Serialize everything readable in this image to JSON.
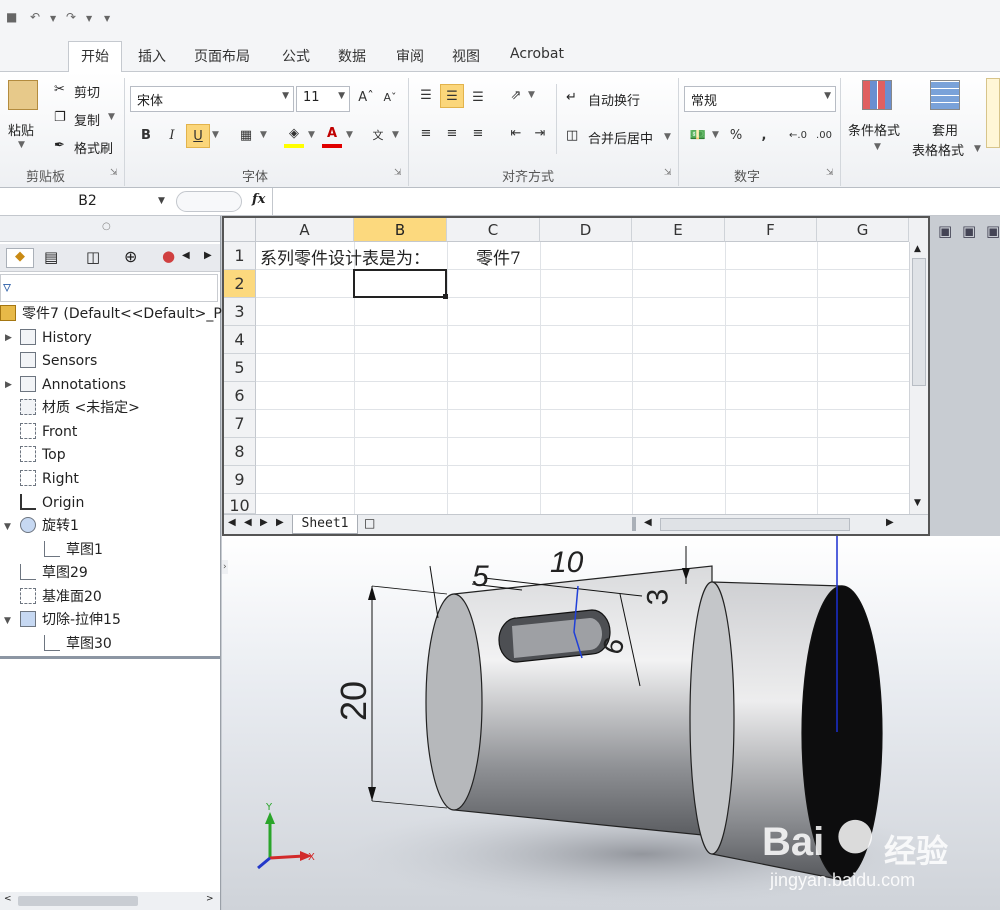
{
  "ribbon": {
    "tabs": [
      "开始",
      "插入",
      "页面布局",
      "公式",
      "数据",
      "审阅",
      "视图",
      "Acrobat"
    ],
    "active_tab": "开始",
    "clipboard": {
      "paste": "粘贴",
      "cut": "剪切",
      "copy": "复制",
      "format_painter": "格式刷",
      "group": "剪贴板"
    },
    "font": {
      "name": "宋体",
      "size": "11",
      "bold": "B",
      "italic": "I",
      "underline": "U",
      "group": "字体"
    },
    "alignment": {
      "wrap": "自动换行",
      "merge": "合并后居中",
      "group": "对齐方式"
    },
    "number": {
      "format": "常规",
      "percent": "%",
      "comma": ",",
      "group": "数字"
    },
    "styles": {
      "conditional": "条件格式",
      "table_line1": "套用",
      "table_line2": "表格格式"
    }
  },
  "formula_bar": {
    "cell_ref": "B2",
    "fx": "fx",
    "content": ""
  },
  "sheet": {
    "columns": [
      "A",
      "B",
      "C",
      "D",
      "E",
      "F",
      "G"
    ],
    "selected_column": "B",
    "rows": [
      "1",
      "2",
      "3",
      "4",
      "5",
      "6",
      "7",
      "8",
      "9",
      "10"
    ],
    "selected_row": "2",
    "cell_a1": "系列零件设计表是为：",
    "cell_c1": "零件7",
    "tab_name": "Sheet1"
  },
  "tree": {
    "root": "零件7  (Default<<Default>_P",
    "items": [
      "History",
      "Sensors",
      "Annotations",
      "材质 <未指定>",
      "Front",
      "Top",
      "Right",
      "Origin",
      "旋转1",
      "草图1",
      "草图29",
      "基准面20",
      "切除-拉伸15",
      "草图30"
    ]
  },
  "dimensions": {
    "d10": "10",
    "d5": "5",
    "d3": "3",
    "d6": "6",
    "d20": "20"
  },
  "triad": {
    "x": "X",
    "y": "Y"
  },
  "watermark": {
    "brand": "Bai",
    "brand_cn": "经验",
    "url": "jingyan.baidu.com"
  },
  "colors": {
    "selected_header": "#fcd97e",
    "ribbon_bg": "#f4f5f7",
    "part_gray": "#8d8f93"
  }
}
